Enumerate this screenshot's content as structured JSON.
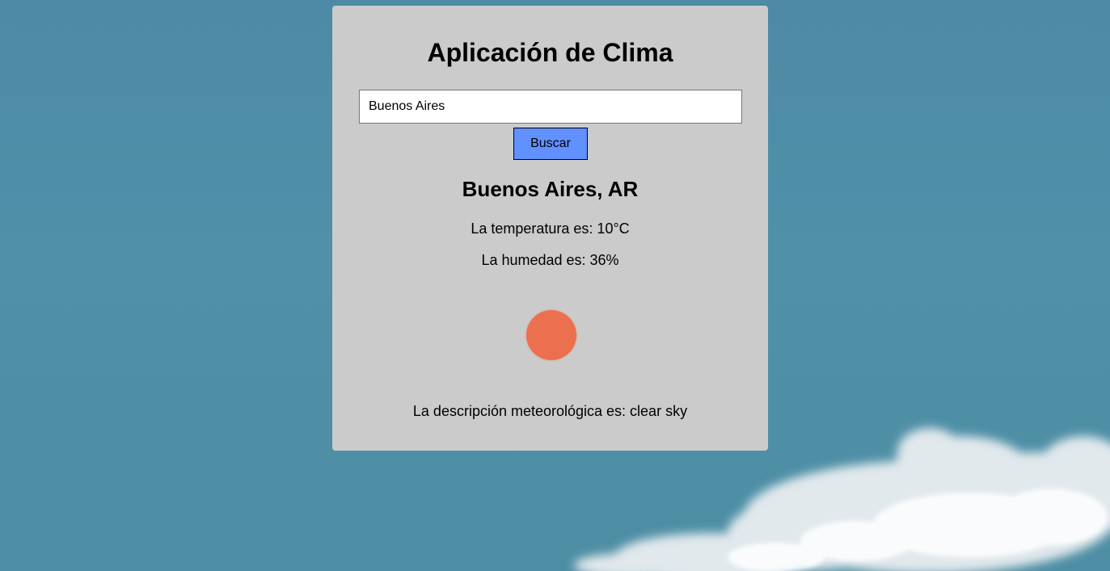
{
  "app": {
    "title": "Aplicación de Clima"
  },
  "search": {
    "value": "Buenos Aires",
    "button_label": "Buscar"
  },
  "weather": {
    "location": "Buenos Aires, AR",
    "temperature_text": "La temperatura es: 10°C",
    "humidity_text": "La humedad es: 36%",
    "icon": "sun-icon",
    "description_text": "La descripción meteorológica es: clear sky"
  },
  "colors": {
    "background_sky": "#4e8da8",
    "card": "#cbcbcb",
    "button": "#6190ff",
    "sun": "#ec6f4f"
  }
}
